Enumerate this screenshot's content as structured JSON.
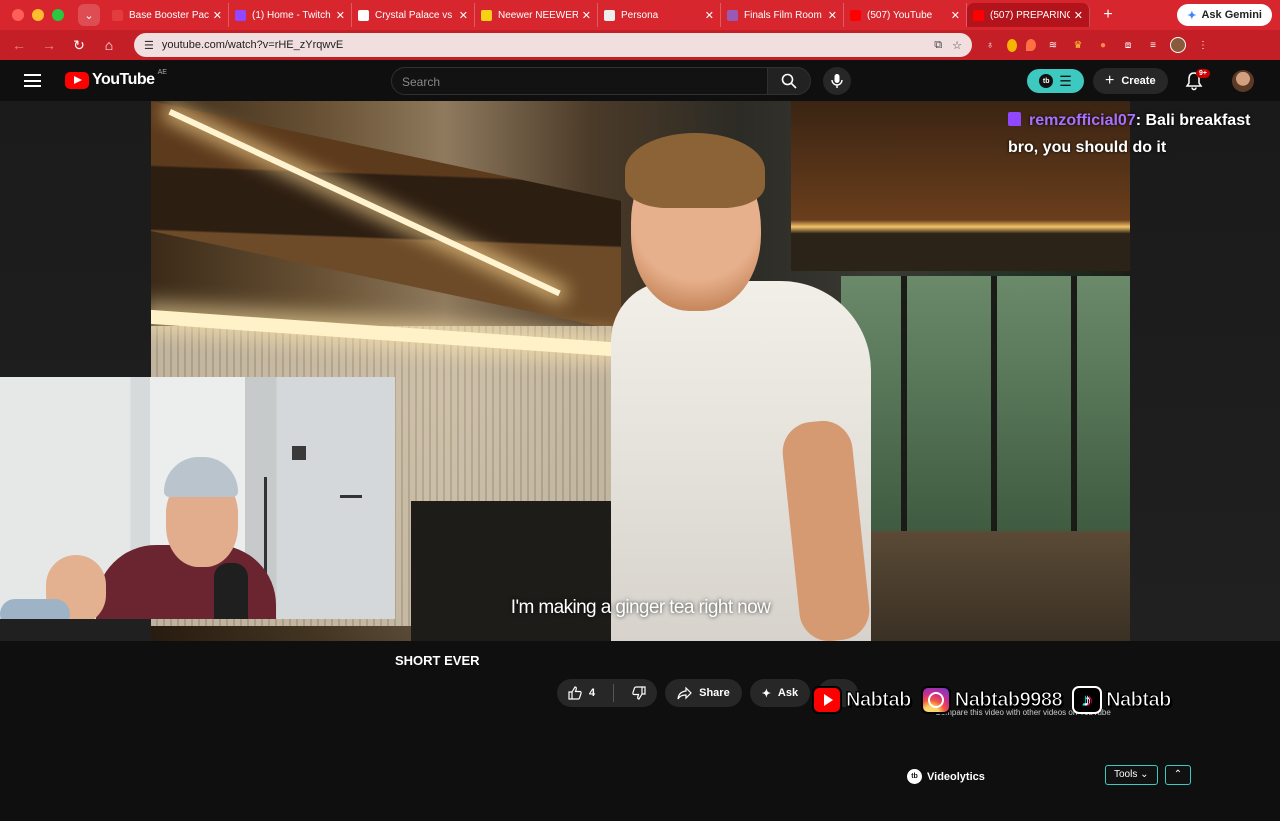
{
  "browser": {
    "tabs": [
      {
        "title": "Base Booster Pac",
        "favicon_color": "#e23c3c",
        "active": false
      },
      {
        "title": "(1) Home - Twitch",
        "favicon_color": "#9146ff",
        "active": false
      },
      {
        "title": "Crystal Palace vs",
        "favicon_color": "#ffffff",
        "active": false
      },
      {
        "title": "Neewer NEEWER",
        "favicon_color": "#f7d117",
        "active": false
      },
      {
        "title": "Persona",
        "favicon_color": "#eeeeee",
        "active": false
      },
      {
        "title": "Finals Film Room",
        "favicon_color": "#9b59b6",
        "active": false
      },
      {
        "title": "(507) YouTube",
        "favicon_color": "#ff0000",
        "active": false
      },
      {
        "title": "(507) PREPARING",
        "favicon_color": "#ff0000",
        "active": true
      }
    ],
    "ask_gemini_label": "Ask Gemini",
    "url": "youtube.com/watch?v=rHE_zYrqwvE",
    "accent_color": "#d7262e"
  },
  "youtube": {
    "logo_text": "YouTube",
    "country_code": "AE",
    "search_placeholder": "Search",
    "create_label": "Create",
    "notification_badge": "9+",
    "video_title_fragment": "SHORT EVER",
    "subtitle": "I'm making a ginger tea right now",
    "like_count": "4",
    "share_label": "Share",
    "ask_label": "Ask"
  },
  "chat_overlay": {
    "username": "remzofficial07",
    "message": ": Bali breakfast bro, you should do it"
  },
  "videolytics": {
    "name": "Videolytics",
    "tools_label": "Tools",
    "bottom_text": "Compare this video with other videos on YouTube"
  },
  "socials": {
    "youtube": "Nabtab",
    "instagram": "Nabtab9988",
    "tiktok": "Nabtab"
  }
}
